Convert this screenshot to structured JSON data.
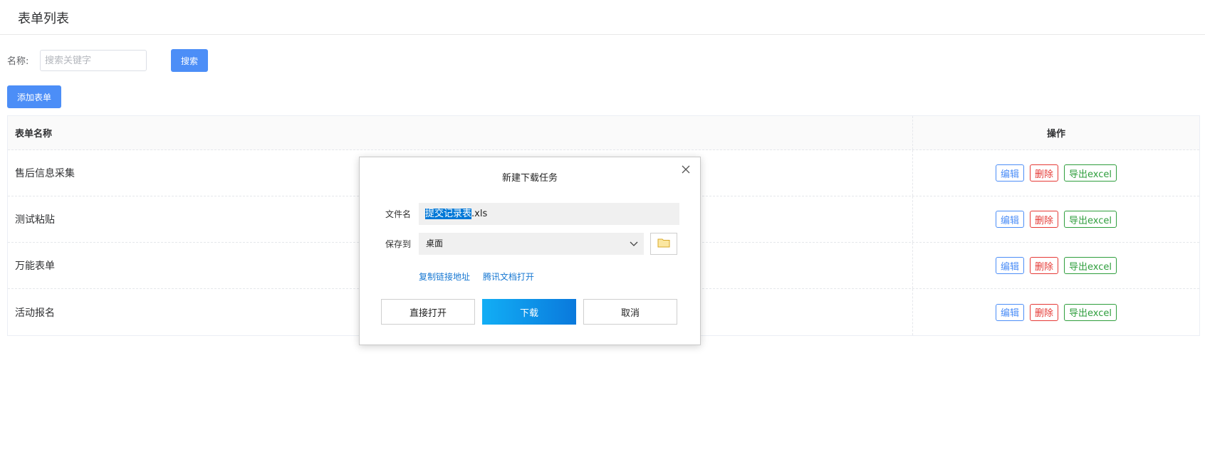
{
  "header": {
    "title": "表单列表"
  },
  "search": {
    "label": "名称:",
    "placeholder": "搜索关键字",
    "button": "搜索"
  },
  "add_button": "添加表单",
  "table": {
    "columns": [
      "表单名称",
      "操作"
    ],
    "rows": [
      {
        "name": "售后信息采集"
      },
      {
        "name": "测试粘贴"
      },
      {
        "name": "万能表单"
      },
      {
        "name": "活动报名"
      }
    ],
    "actions": {
      "edit": "编辑",
      "delete": "删除",
      "export": "导出excel"
    }
  },
  "dialog": {
    "title": "新建下载任务",
    "filename_label": "文件名",
    "filename_selected": "提交记录表",
    "filename_ext": ".xls",
    "saveto_label": "保存到",
    "saveto_value": "桌面",
    "link_copy": "复制链接地址",
    "link_tencent": "腾讯文档打开",
    "btn_open": "直接打开",
    "btn_download": "下载",
    "btn_cancel": "取消"
  },
  "icons": {
    "close": "close-icon",
    "chevron": "chevron-down-icon",
    "folder": "folder-icon"
  },
  "colors": {
    "primary": "#4c8ef7",
    "danger": "#e53935",
    "success": "#2e9e3c",
    "link": "#1677d2"
  }
}
